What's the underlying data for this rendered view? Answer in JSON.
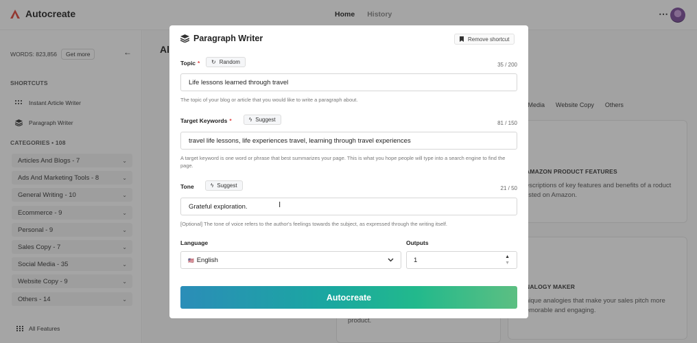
{
  "app": {
    "name": "Autocreate",
    "nav": [
      "Home",
      "History"
    ]
  },
  "sidebar": {
    "words_label": "WORDS: 823,856",
    "get_more": "Get more",
    "shortcuts_title": "SHORTCUTS",
    "shortcuts": [
      "Instant Article Writer",
      "Paragraph Writer"
    ],
    "categories_title": "CATEGORIES • 108",
    "categories": [
      "Articles And Blogs - 7",
      "Ads And Marketing Tools - 8",
      "General Writing - 10",
      "Ecommerce - 9",
      "Personal - 9",
      "Sales Copy - 7",
      "Social Media - 35",
      "Website Copy - 9",
      "Others - 14"
    ],
    "all_features": "All Features"
  },
  "background": {
    "title_fragment": "All",
    "filter_tabs": [
      "al Media",
      "Website Copy",
      "Others"
    ],
    "cards": [
      {
        "title": "AMAZON PRODUCT FEATURES",
        "desc": "escriptions of key features and benefits of a roduct listed on Amazon."
      },
      {
        "title": "NALOGY MAKER",
        "desc": "nique analogies that make your sales pitch more emorable and engaging."
      }
    ],
    "partial_text": "product."
  },
  "modal": {
    "title": "Paragraph Writer",
    "remove_shortcut": "Remove shortcut",
    "topic": {
      "label": "Topic",
      "chip": "Random",
      "counter": "35 / 200",
      "value": "Life lessons learned through travel",
      "help": "The topic of your blog or article that you would like to write a paragraph about."
    },
    "keywords": {
      "label": "Target Keywords",
      "chip": "Suggest",
      "counter": "81 / 150",
      "value": "travel life lessons, life experiences travel, learning through travel experiences",
      "help": "A target keyword is one word or phrase that best summarizes your page. This is what you hope people will type into a search engine to find the page."
    },
    "tone": {
      "label": "Tone",
      "chip": "Suggest",
      "counter": "21 / 50",
      "value": "Grateful exploration.",
      "help": "[Optional] The tone of voice refers to the author's feelings towards the subject, as expressed through the writing itself."
    },
    "language": {
      "label": "Language",
      "flag": "🇺🇸",
      "value": "English"
    },
    "outputs": {
      "label": "Outputs",
      "value": "1"
    },
    "submit": "Autocreate"
  }
}
